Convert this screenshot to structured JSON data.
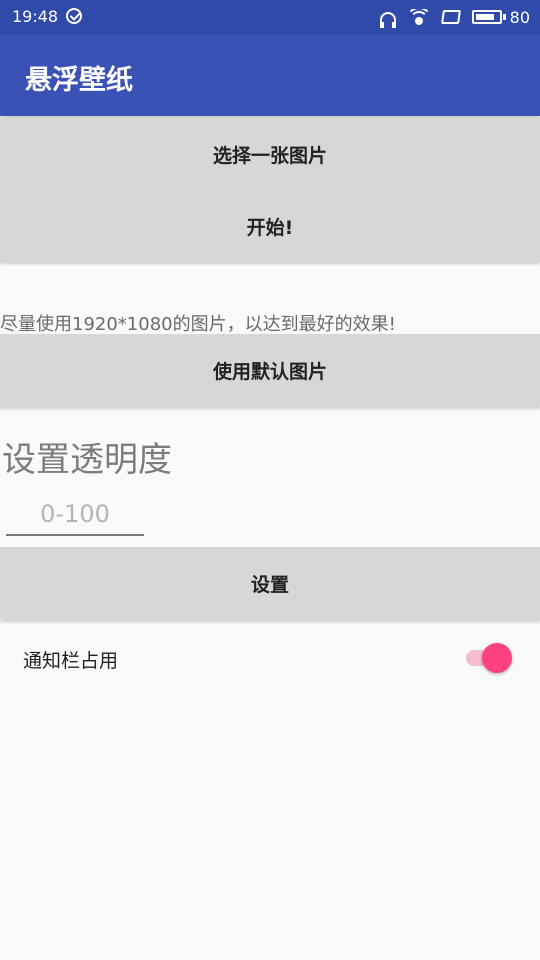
{
  "status_bar": {
    "time": "19:48",
    "battery_level": "80",
    "battery_fraction": 0.8,
    "icons": [
      "check-circle-icon",
      "headset-icon",
      "wifi-icon",
      "screen-mirror-icon",
      "battery-icon"
    ]
  },
  "app_bar": {
    "title": "悬浮壁纸",
    "color": "#3a51b5"
  },
  "main": {
    "select_image_label": "选择一张图片",
    "start_label": "开始!",
    "hint_text": "尽量使用1920*1080的图片，以达到最好的效果!",
    "default_image_label": "使用默认图片",
    "opacity_title": "设置透明度",
    "opacity_input": {
      "value": "",
      "placeholder": "0-100"
    },
    "set_label": "设置",
    "notification_switch": {
      "label": "通知栏占用",
      "checked": true,
      "accent_color": "#ff4081"
    }
  }
}
